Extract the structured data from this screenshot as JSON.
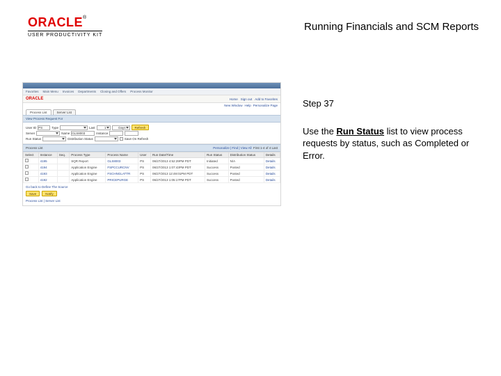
{
  "header": {
    "brand": "ORACLE",
    "tm": "®",
    "subline": "USER PRODUCTIVITY KIT",
    "title": "Running Financials and SCM Reports"
  },
  "right_panel": {
    "step": "Step 37",
    "instruction_pre": "Use the ",
    "instruction_bold": "Run Status",
    "instruction_post": " list to view process requests by status, such as Completed or Error."
  },
  "thumb": {
    "menubar": [
      "Favorites",
      "Main Menu",
      "Invoices",
      "Departments",
      "Closing and Offers",
      "Process Monitor"
    ],
    "top_right_links": [
      "Home",
      "Sign out",
      "Add to Favorites"
    ],
    "user_links": [
      "New Window",
      "Help",
      "Personalize Page"
    ],
    "tabs": [
      "Process List",
      "Server List"
    ],
    "section_title": "View Process Request For",
    "form": {
      "user_id_label": "User ID",
      "user_id_value": "PS",
      "type_label": "Type",
      "last_label": "Last",
      "last_value": "1",
      "last_unit": "Days",
      "refresh": "Refresh",
      "server_label": "Server",
      "name_label": "Name",
      "name_value": "GLS8003",
      "instance_label": "Instance",
      "run_status_label": "Run Status",
      "dist_status_label": "Distribution Status",
      "save_label": "Save On Refresh"
    },
    "list": {
      "header": "Process List",
      "meta": "Personalize | Find | View All",
      "range": "First 1-4 of 4 Last",
      "cols": [
        "Select",
        "Instance",
        "Seq.",
        "Process Type",
        "Process Name",
        "User",
        "Run Date/Time",
        "Run Status",
        "Distribution Status",
        "Details"
      ],
      "rows": [
        {
          "sel": "",
          "inst": "4195",
          "seq": "",
          "ptype": "SQR Report",
          "pname": "GLS8003",
          "user": "PS",
          "dt": "06/27/2013 4:52:29PM PDT",
          "rstat": "Initiated",
          "dstat": "N/A",
          "det": "Details"
        },
        {
          "sel": "",
          "inst": "4194",
          "seq": "",
          "ptype": "Application Engine",
          "pname": "FSPCCURCNV",
          "user": "PS",
          "dt": "06/27/2013 1:07:43PM PDT",
          "rstat": "Success",
          "dstat": "Posted",
          "det": "Details"
        },
        {
          "sel": "",
          "inst": "4193",
          "seq": "",
          "ptype": "Application Engine",
          "pname": "FSCHNGLATTR",
          "user": "PS",
          "dt": "06/27/2013 12:49:01PM PDT",
          "rstat": "Success",
          "dstat": "Posted",
          "det": "Details"
        },
        {
          "sel": "",
          "inst": "4192",
          "seq": "",
          "ptype": "Application Engine",
          "pname": "PRICEPURGE",
          "user": "PS",
          "dt": "06/27/2013 1:05:17PM PDT",
          "rstat": "Success",
          "dstat": "Posted",
          "det": "Details"
        }
      ]
    },
    "footer_link": "Go back to Define The Source",
    "save_btn": "Save",
    "notify_btn": "Notify",
    "bottom_tab": "Process List | Server List"
  }
}
